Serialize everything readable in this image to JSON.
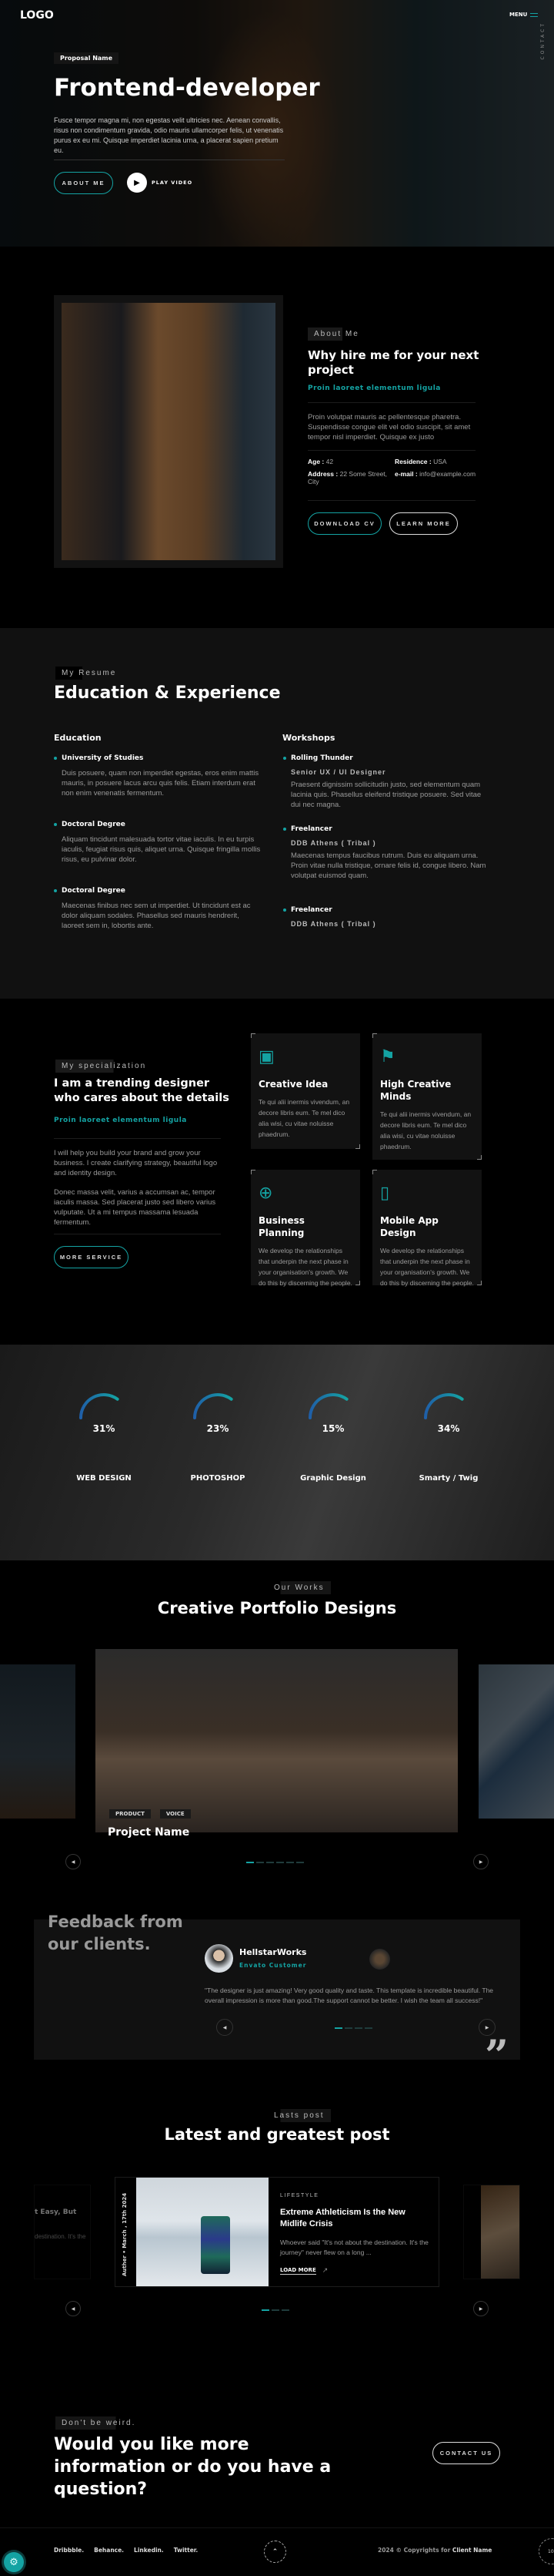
{
  "colors": {
    "accent": "#14a3a3",
    "bg": "#000000",
    "panel": "#111111"
  },
  "header": {
    "logo": "LOGO",
    "menu": "MENU",
    "contact": "CONTACT"
  },
  "hero": {
    "tag": "Proposal Name",
    "title": "Frontend-developer",
    "text": "Fusce tempor magna mi, non egestas velit ultricies nec. Aenean convallis, risus non condimentum gravida, odio mauris ullamcorper felis, ut venenatis purus ex eu mi. Quisque imperdiet lacinia urna, a placerat sapien pretium eu.",
    "about_btn": "ABOUT ME",
    "play_btn": "PLAY VIDEO"
  },
  "about": {
    "tag": "About Me",
    "title": "Why hire me for your next project",
    "subtitle": "Proin laoreet elementum ligula",
    "text": "Proin volutpat mauris ac pellentesque pharetra. Suspendisse congue elit vel odio suscipit, sit amet tempor nisl imperdiet. Quisque ex justo",
    "info": [
      {
        "label": "Age :",
        "value": "42"
      },
      {
        "label": "Residence :",
        "value": "USA"
      },
      {
        "label": "Address :",
        "value": "22 Some Street, City"
      },
      {
        "label": "e-mail :",
        "value": "info@example.com"
      }
    ],
    "download_btn": "DOWNLOAD CV",
    "learn_btn": "LEARN MORE"
  },
  "resume": {
    "tag": "My Resume",
    "title": "Education & Experience",
    "education": {
      "heading": "Education",
      "items": [
        {
          "title": "University of Studies",
          "text": "Duis posuere, quam non imperdiet egestas, eros enim mattis mauris, in posuere lacus arcu quis felis. Etiam interdum erat non enim venenatis fermentum."
        },
        {
          "title": "Doctoral Degree",
          "text": "Aliquam tincidunt malesuada tortor vitae iaculis. In eu turpis iaculis, feugiat risus quis, aliquet urna. Quisque fringilla mollis risus, eu pulvinar dolor."
        },
        {
          "title": "Doctoral Degree",
          "text": "Maecenas finibus nec sem ut imperdiet. Ut tincidunt est ac dolor aliquam sodales. Phasellus sed mauris hendrerit, laoreet sem in, lobortis ante."
        }
      ]
    },
    "workshops": {
      "heading": "Workshops",
      "items": [
        {
          "title": "Rolling Thunder",
          "sub": "Senior UX / UI Designer",
          "text": "Praesent dignissim sollicitudin justo, sed elementum quam lacinia quis. Phasellus eleifend tristique posuere. Sed vitae dui nec magna."
        },
        {
          "title": "Freelancer",
          "sub": "DDB Athens ( Tribal )",
          "text": "Maecenas tempus faucibus rutrum. Duis eu aliquam urna. Proin vitae nulla tristique, ornare felis id, congue libero. Nam volutpat euismod quam."
        },
        {
          "title": "Freelancer",
          "sub": "DDB Athens ( Tribal )"
        }
      ]
    }
  },
  "special": {
    "tag": "My specialization",
    "title": "I am a trending designer who cares about the details",
    "subtitle": "Proin laoreet elementum ligula",
    "text1": "I will help you build your brand and grow your business. I create clarifying strategy, beautiful logo and identity design.",
    "text2": "Donec massa velit, varius a accumsan ac, tempor iaculis massa. Sed placerat justo sed libero varius vulputate. Ut a mi tempus massama lesuada fermentum.",
    "button": "MORE SERVICE",
    "cards": [
      {
        "icon": "presentation-icon",
        "title": "Creative Idea",
        "text": "Te qui alii inermis vivendum, an decore libris eum. Te mel dico alia wisi, cu vitae noluisse phaedrum."
      },
      {
        "icon": "rocket-icon",
        "title": "High Creative Minds",
        "text": "Te qui alii inermis vivendum, an decore libris eum. Te mel dico alia wisi, cu vitae noluisse phaedrum."
      },
      {
        "icon": "briefcase-globe-icon",
        "title": "Business Planning",
        "text": "We develop the relationships that underpin the next phase in your organisation's growth. We do this by discerning the people."
      },
      {
        "icon": "mobile-pen-icon",
        "title": "Mobile App Design",
        "text": "We develop the relationships that underpin the next phase in your organisation's growth. We do this by discerning the people."
      }
    ]
  },
  "skills": [
    {
      "label": "WEB DESIGN",
      "value": 31,
      "text": "31%"
    },
    {
      "label": "PHOTOSHOP",
      "value": 23,
      "text": "23%"
    },
    {
      "label": "Graphic Design",
      "value": 15,
      "text": "15%"
    },
    {
      "label": "Smarty / Twig",
      "value": 34,
      "text": "34%"
    }
  ],
  "portfolio": {
    "tag": "Our Works",
    "title": "Creative Portfolio Designs",
    "tags": [
      "PRODUCT",
      "VOICE"
    ],
    "project": "Project Name",
    "active_slide": 1,
    "slides": 6
  },
  "feedback": {
    "title": "Feedback from our clients.",
    "name": "HellstarWorks",
    "role": "Envato Customer",
    "quote": "\"The designer is just amazing! Very good quality and taste. This template is incredible beautiful. The overall impression is more than good.The support cannot be better. I wish the team all success!\"",
    "slides": 4
  },
  "posts": {
    "tag": "Lasts post",
    "title": "Latest and greatest post",
    "side_left": "t Easy, But",
    "side_left2": "destination. It's the",
    "meta": "Auther  •  March , 17th 2024",
    "category": "LIFESTYLE",
    "post_title": "Extreme Athleticism Is the New Midlife Crisis",
    "excerpt": "Whoever said \"It's not about the destination. It's the journey\" never flew on a long ...",
    "more": "LOAD MORE",
    "slides": 3
  },
  "contact": {
    "tag": "Don't be weird.",
    "title": "Would you like more information or do you have a question?",
    "button": "CONTACT US"
  },
  "footer": {
    "links": [
      "Dribbble.",
      "Behance.",
      "Linkedin.",
      "Twitter."
    ],
    "copyright": "2024 © Copyrights for",
    "client": "Client Name",
    "scroll_pct": "100"
  }
}
